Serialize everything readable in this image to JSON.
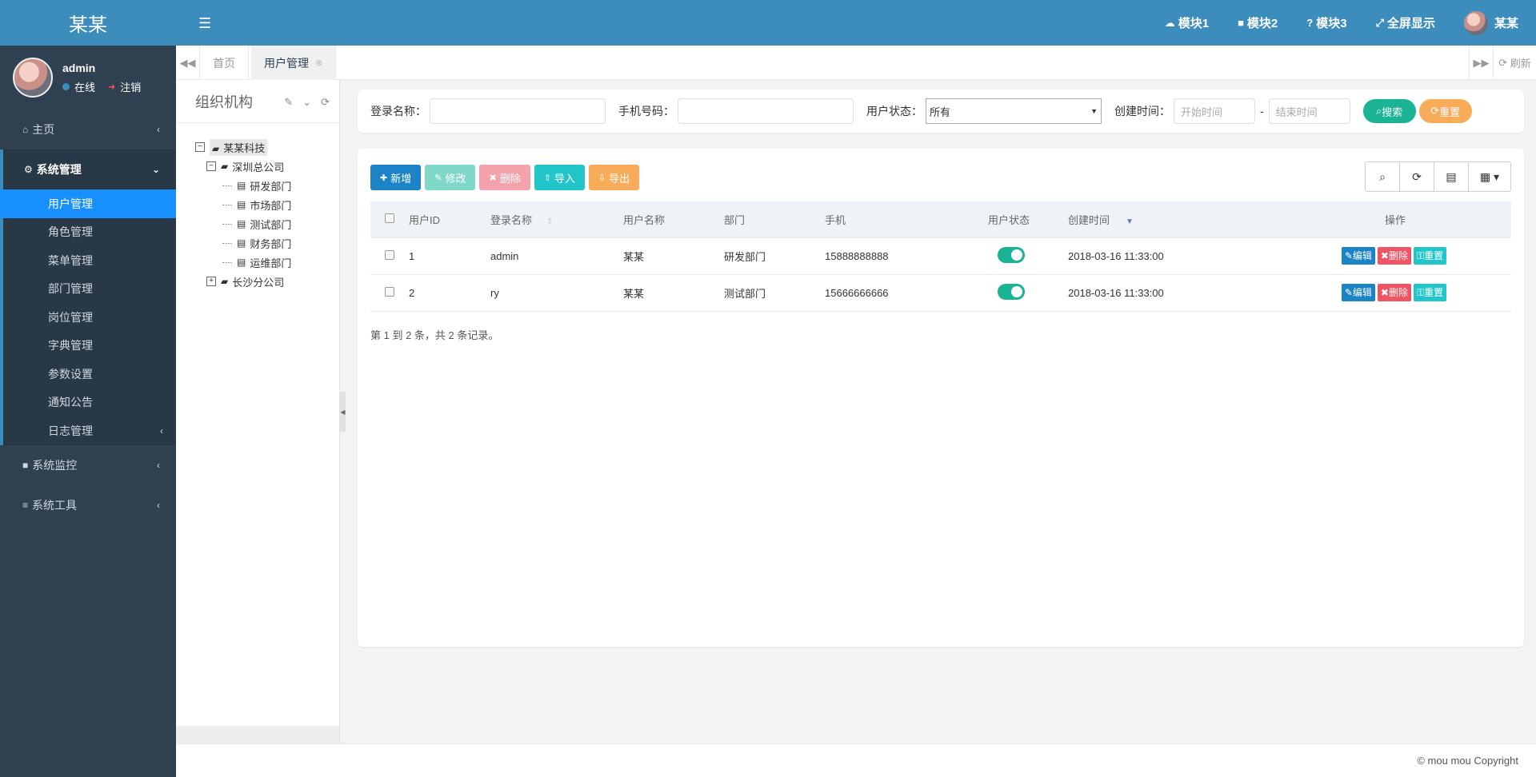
{
  "brand": "某某",
  "user": {
    "name": "admin",
    "status": "在线",
    "logout": "注销"
  },
  "sidebar": {
    "home": "主页",
    "system": "系统管理",
    "sub_items": [
      "用户管理",
      "角色管理",
      "菜单管理",
      "部门管理",
      "岗位管理",
      "字典管理",
      "参数设置",
      "通知公告",
      "日志管理"
    ],
    "monitor": "系统监控",
    "tools": "系统工具"
  },
  "header": {
    "links": [
      "模块1",
      "模块2",
      "模块3",
      "全屏显示"
    ],
    "username": "某某"
  },
  "tabs": {
    "home": "首页",
    "active": "用户管理",
    "refresh": "刷新"
  },
  "org": {
    "title": "组织机构",
    "root": "某某科技",
    "company1": "深圳总公司",
    "depts": [
      "研发部门",
      "市场部门",
      "测试部门",
      "财务部门",
      "运维部门"
    ],
    "company2": "长沙分公司"
  },
  "search": {
    "login_label": "登录名称：",
    "phone_label": "手机号码：",
    "status_label": "用户状态：",
    "status_value": "所有",
    "time_label": "创建时间：",
    "start_placeholder": "开始时间",
    "end_placeholder": "结束时间",
    "dash": "-",
    "search_btn": "搜索",
    "reset_btn": "重置"
  },
  "toolbar": {
    "add": "新增",
    "edit": "修改",
    "delete": "删除",
    "import": "导入",
    "export": "导出"
  },
  "table": {
    "headers": [
      "用户ID",
      "登录名称",
      "用户名称",
      "部门",
      "手机",
      "用户状态",
      "创建时间",
      "操作"
    ],
    "rows": [
      {
        "id": "1",
        "login": "admin",
        "name": "某某",
        "dept": "研发部门",
        "phone": "15888888888",
        "enabled": true,
        "created": "2018-03-16 11:33:00"
      },
      {
        "id": "2",
        "login": "ry",
        "name": "某某",
        "dept": "测试部门",
        "phone": "15666666666",
        "enabled": true,
        "created": "2018-03-16 11:33:00"
      }
    ],
    "action_edit": "编辑",
    "action_delete": "删除",
    "action_reset": "重置",
    "summary": "第 1 到 2 条，共 2 条记录。"
  },
  "footer": "© mou mou Copyright",
  "colors": {
    "primary": "#3c8dbc",
    "sidebar": "#2f4050",
    "active": "#1890ff",
    "green": "#1ab394",
    "orange": "#f8ac59",
    "red": "#ed5565",
    "teal": "#23c6c8"
  }
}
